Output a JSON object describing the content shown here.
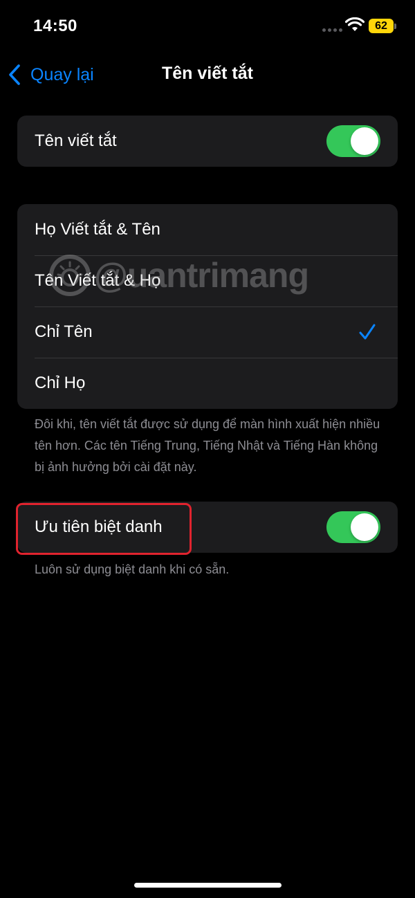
{
  "status_bar": {
    "time": "14:50",
    "battery_level": "62",
    "battery_color": "#ffd60a",
    "icons": [
      "signal-dots-icon",
      "wifi-icon",
      "battery-icon"
    ]
  },
  "nav": {
    "back_label": "Quay lại",
    "title": "Tên viết tắt"
  },
  "short_name_group": {
    "label": "Tên viết tắt",
    "enabled": true
  },
  "format_group": {
    "options": [
      {
        "label": "Họ Viết tắt & Tên",
        "selected": false
      },
      {
        "label": "Tên Viết tắt & Họ",
        "selected": false
      },
      {
        "label": "Chỉ Tên",
        "selected": true
      },
      {
        "label": "Chỉ Họ",
        "selected": false
      }
    ],
    "footer": "Đôi khi, tên viết tắt được sử dụng để màn hình xuất hiện nhiều tên hơn. Các tên Tiếng Trung, Tiếng Nhật và Tiếng Hàn không bị ảnh hưởng bởi cài đặt này."
  },
  "nickname_group": {
    "label": "Ưu tiên biệt danh",
    "enabled": true,
    "footer": "Luôn sử dụng biệt danh khi có sẵn."
  },
  "watermark": {
    "text": "@uantrimang"
  },
  "colors": {
    "accent": "#0a84ff",
    "toggle_on": "#34c759",
    "highlight": "#e0232e",
    "cell_background": "#1c1c1e"
  }
}
